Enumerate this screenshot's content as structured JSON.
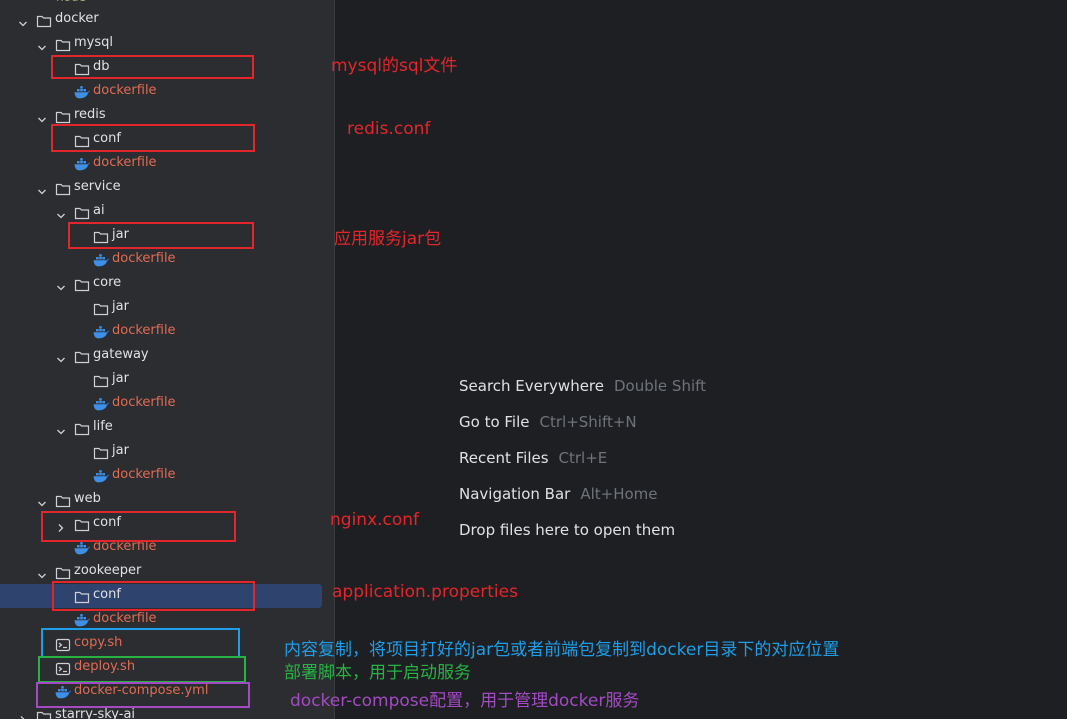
{
  "project_tree": {
    "top_partial": "node",
    "nodes": [
      {
        "label": "docker",
        "kind": "folder",
        "expanded": true
      },
      {
        "label": "mysql",
        "kind": "folder",
        "expanded": true
      },
      {
        "label": "db",
        "kind": "folder"
      },
      {
        "label": "dockerfile",
        "kind": "docker"
      },
      {
        "label": "redis",
        "kind": "folder",
        "expanded": true
      },
      {
        "label": "conf",
        "kind": "folder"
      },
      {
        "label": "dockerfile",
        "kind": "docker"
      },
      {
        "label": "service",
        "kind": "folder",
        "expanded": true
      },
      {
        "label": "ai",
        "kind": "folder",
        "expanded": true
      },
      {
        "label": "jar",
        "kind": "folder"
      },
      {
        "label": "dockerfile",
        "kind": "docker"
      },
      {
        "label": "core",
        "kind": "folder",
        "expanded": true
      },
      {
        "label": "jar",
        "kind": "folder"
      },
      {
        "label": "dockerfile",
        "kind": "docker"
      },
      {
        "label": "gateway",
        "kind": "folder",
        "expanded": true
      },
      {
        "label": "jar",
        "kind": "folder"
      },
      {
        "label": "dockerfile",
        "kind": "docker"
      },
      {
        "label": "life",
        "kind": "folder",
        "expanded": true
      },
      {
        "label": "jar",
        "kind": "folder"
      },
      {
        "label": "dockerfile",
        "kind": "docker"
      },
      {
        "label": "web",
        "kind": "folder",
        "expanded": true
      },
      {
        "label": "conf",
        "kind": "folder",
        "expanded": false
      },
      {
        "label": "dockerfile",
        "kind": "docker"
      },
      {
        "label": "zookeeper",
        "kind": "folder",
        "expanded": true
      },
      {
        "label": "conf",
        "kind": "folder",
        "selected": true
      },
      {
        "label": "dockerfile",
        "kind": "docker"
      },
      {
        "label": "copy.sh",
        "kind": "script"
      },
      {
        "label": "deploy.sh",
        "kind": "script"
      },
      {
        "label": "docker-compose.yml",
        "kind": "docker"
      },
      {
        "label": "starry-sky-ai",
        "kind": "folder",
        "expanded": false
      }
    ]
  },
  "annotations": {
    "mysql": "mysql的sql文件",
    "redis": "redis.conf",
    "jar": "应用服务jar包",
    "nginx": "nginx.conf",
    "app_props": "application.properties",
    "copy": "内容复制，将项目打好的jar包或者前端包复制到docker目录下的对应位置",
    "deploy": "部署脚本，用于启动服务",
    "compose": "docker-compose配置，用于管理docker服务"
  },
  "editor_hints": [
    {
      "action": "Search Everywhere",
      "shortcut": "Double Shift"
    },
    {
      "action": "Go to File",
      "shortcut": "Ctrl+Shift+N"
    },
    {
      "action": "Recent Files",
      "shortcut": "Ctrl+E"
    },
    {
      "action": "Navigation Bar",
      "shortcut": "Alt+Home"
    },
    {
      "action": "Drop files here to open them",
      "shortcut": ""
    }
  ],
  "colors": {
    "panel_bg": "#2b2d30",
    "editor_bg": "#1e1f22",
    "selection": "#2e436e",
    "docker_file_text": "#e06c54",
    "annotation_red": "#e3262b",
    "annotation_blue": "#1e9ee8",
    "annotation_green": "#27b344",
    "annotation_purple": "#a24bc3"
  }
}
